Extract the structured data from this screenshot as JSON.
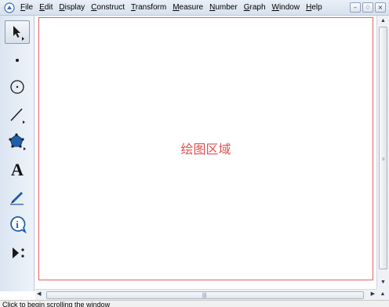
{
  "menubar": {
    "items": [
      {
        "label": "File",
        "u": "F",
        "rest": "ile"
      },
      {
        "label": "Edit",
        "u": "E",
        "rest": "dit"
      },
      {
        "label": "Display",
        "u": "D",
        "rest": "isplay"
      },
      {
        "label": "Construct",
        "u": "C",
        "rest": "onstruct"
      },
      {
        "label": "Transform",
        "u": "T",
        "rest": "ransform"
      },
      {
        "label": "Measure",
        "u": "M",
        "rest": "easure"
      },
      {
        "label": "Number",
        "u": "N",
        "rest": "umber"
      },
      {
        "label": "Graph",
        "u": "G",
        "rest": "raph"
      },
      {
        "label": "Window",
        "u": "W",
        "rest": "indow"
      },
      {
        "label": "Help",
        "u": "H",
        "rest": "elp"
      }
    ],
    "window_buttons": {
      "minimize": "–",
      "restore": "♢",
      "close": "×"
    }
  },
  "toolbox": {
    "tools": [
      {
        "name": "arrow-tool",
        "icon": "arrow-select-icon",
        "selected": true
      },
      {
        "name": "point-tool",
        "icon": "point-icon"
      },
      {
        "name": "compass-tool",
        "icon": "circle-icon"
      },
      {
        "name": "straightedge-tool",
        "icon": "line-icon"
      },
      {
        "name": "polygon-tool",
        "icon": "pentagon-icon"
      },
      {
        "name": "text-tool",
        "icon": "text-a-icon",
        "glyph": "A"
      },
      {
        "name": "marker-tool",
        "icon": "pen-icon"
      },
      {
        "name": "information-tool",
        "icon": "info-icon",
        "glyph": "i"
      },
      {
        "name": "custom-tool",
        "icon": "custom-tools-icon"
      }
    ],
    "accent": "#1f5fa8"
  },
  "canvas": {
    "label": "绘图区域",
    "label_color": "#e05050",
    "border_color": "#e06060"
  },
  "status": {
    "text": "Click to begin scrolling the window"
  }
}
